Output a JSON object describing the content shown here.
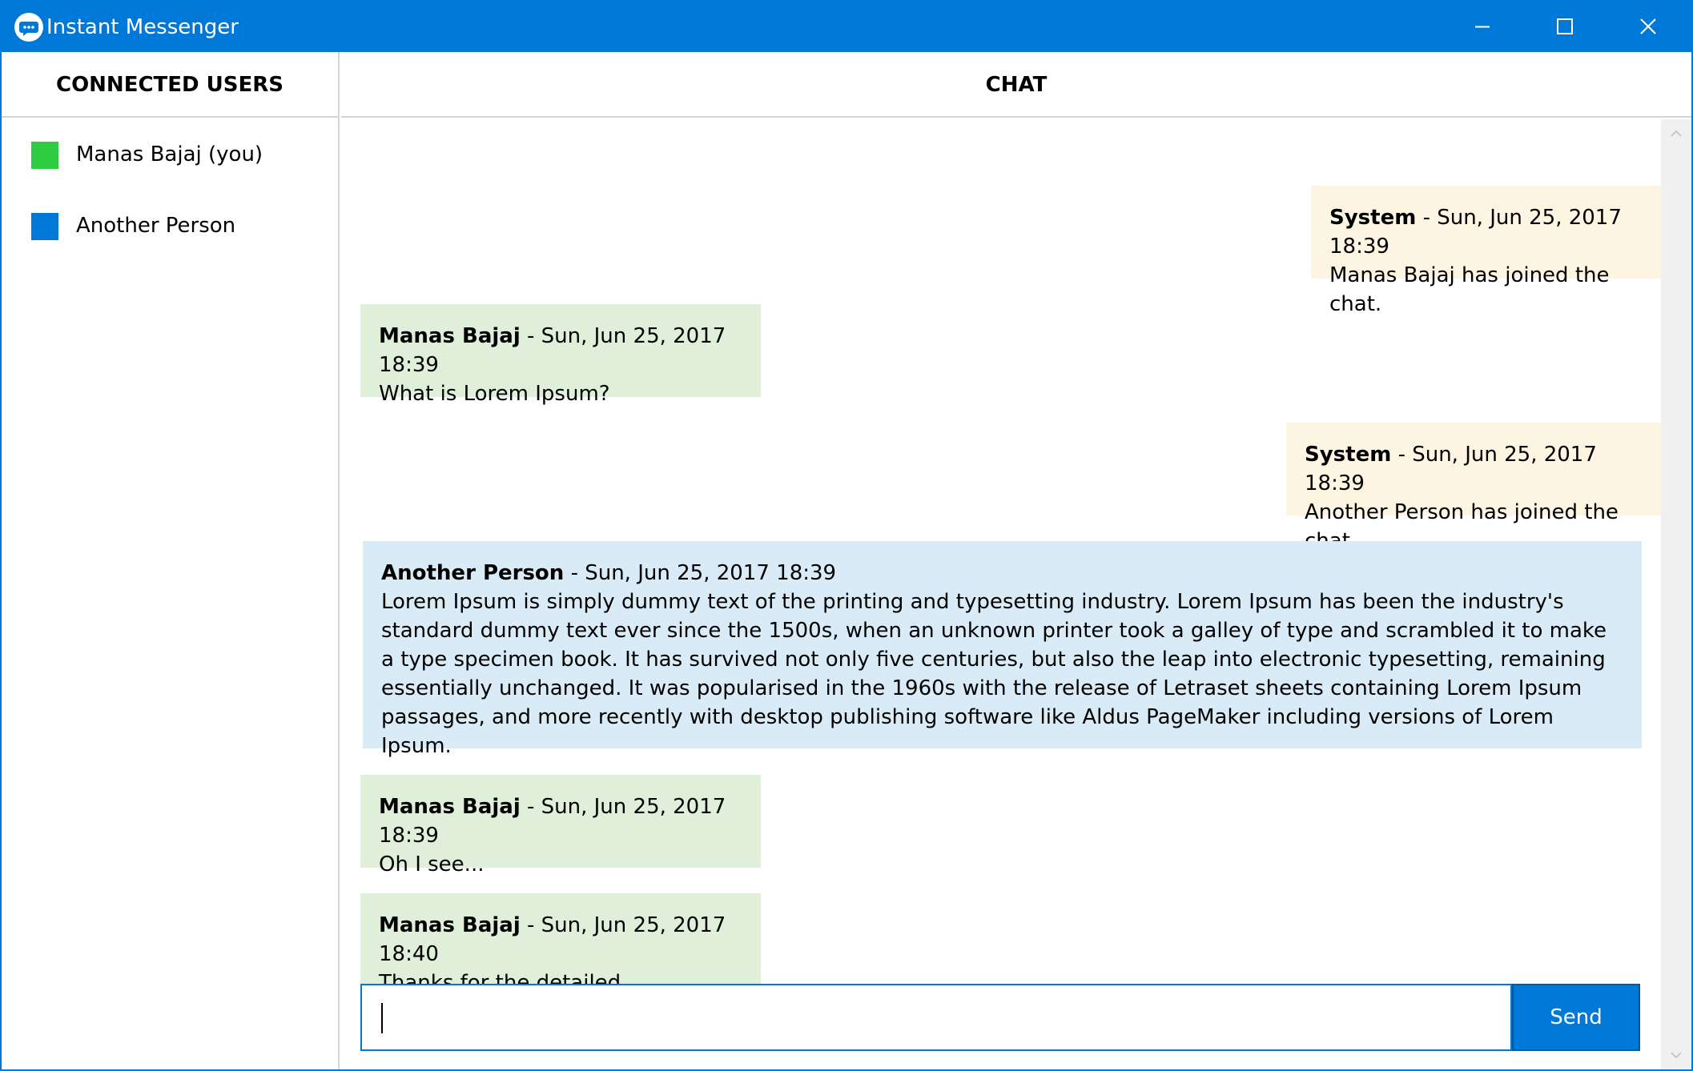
{
  "window": {
    "title": "Instant Messenger",
    "accent_color": "#0078d7",
    "icons": {
      "app": "chat-bubble-icon",
      "minimize": "minimize-icon",
      "maximize": "maximize-icon",
      "close": "close-icon"
    }
  },
  "sidebar": {
    "header": "CONNECTED USERS",
    "users": [
      {
        "name": "Manas Bajaj (you)",
        "color": "#2ecc40"
      },
      {
        "name": "Another Person",
        "color": "#0078d7"
      }
    ]
  },
  "chat": {
    "header": "CHAT",
    "messages": [
      {
        "kind": "system",
        "sender": "System",
        "meta": " - Sun, Jun 25, 2017 18:39",
        "text": "Manas Bajaj has joined the chat."
      },
      {
        "kind": "self",
        "sender": "Manas Bajaj",
        "meta": " - Sun, Jun 25, 2017 18:39",
        "text": "What is Lorem Ipsum?"
      },
      {
        "kind": "system",
        "sender": "System",
        "meta": " - Sun, Jun 25, 2017 18:39",
        "text": "Another Person has joined the chat."
      },
      {
        "kind": "other",
        "sender": "Another Person",
        "meta": " - Sun, Jun 25, 2017 18:39",
        "text": "Lorem Ipsum is simply dummy text of the printing and typesetting industry. Lorem Ipsum has been the industry's standard dummy text ever since the 1500s, when an unknown printer took a galley of type and scrambled it to make a type specimen book. It has survived not only five centuries, but also the leap into electronic typesetting, remaining essentially unchanged. It was popularised in the 1960s with the release of Letraset sheets containing Lorem Ipsum passages, and more recently with desktop publishing software like Aldus PageMaker including versions of Lorem Ipsum."
      },
      {
        "kind": "self",
        "sender": "Manas Bajaj",
        "meta": " - Sun, Jun 25, 2017 18:39",
        "text": "Oh I see..."
      },
      {
        "kind": "self",
        "sender": "Manas Bajaj",
        "meta": " - Sun, Jun 25, 2017 18:40",
        "text": "Thanks for the detailed explanation!"
      }
    ],
    "colors": {
      "system": "#fdf5e1",
      "self": "#dfefd9",
      "other": "#d9ebf6"
    }
  },
  "composer": {
    "input_value": "",
    "send_label": "Send"
  }
}
